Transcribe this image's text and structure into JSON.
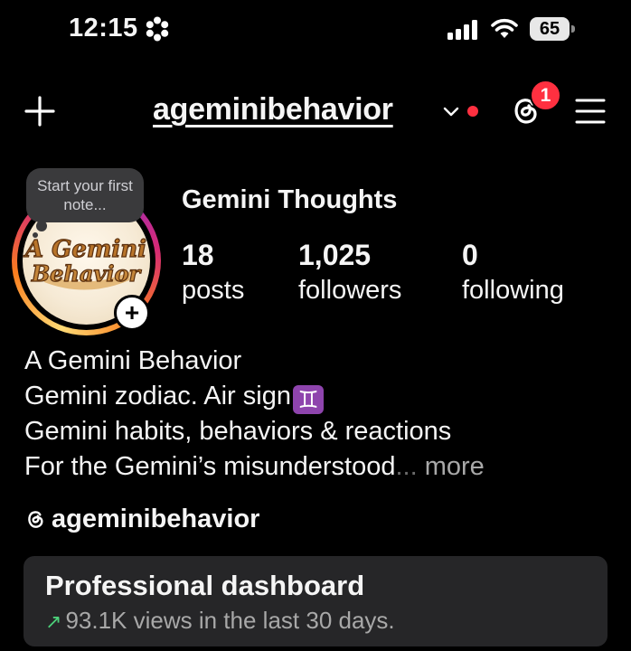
{
  "status_bar": {
    "time": "12:15",
    "battery": "65"
  },
  "nav": {
    "username": "ageminibehavior",
    "threads_badge": "1"
  },
  "note": {
    "placeholder": "Start your first note..."
  },
  "profile": {
    "display_name": "Gemini Thoughts",
    "avatar_text_line1": "A Gemini",
    "avatar_text_line2": "Behavior",
    "stats": [
      {
        "count": "18",
        "label": "posts"
      },
      {
        "count": "1,025",
        "label": "followers"
      },
      {
        "count": "0",
        "label": "following"
      }
    ]
  },
  "bio": {
    "line1": "A Gemini Behavior",
    "line2": "Gemini zodiac. Air sign",
    "line2_emoji": "♊",
    "line3": "Gemini habits, behaviors & reactions",
    "line4": "For the Gemini’s misunderstood",
    "ellipsis": "...",
    "more": "more"
  },
  "threads_link": {
    "handle": "ageminibehavior"
  },
  "dashboard": {
    "title": "Professional dashboard",
    "subtitle": "93.1K views in the last 30 days."
  },
  "colors": {
    "background": "#000000",
    "accent_red": "#ff3040",
    "card": "#262628",
    "trend_green": "#4cd07a"
  },
  "icons": [
    "focus-icon",
    "signal-icon",
    "wifi-icon",
    "add-icon",
    "chevron-down-icon",
    "threads-icon",
    "menu-icon",
    "plus-icon",
    "trend-up-icon"
  ]
}
